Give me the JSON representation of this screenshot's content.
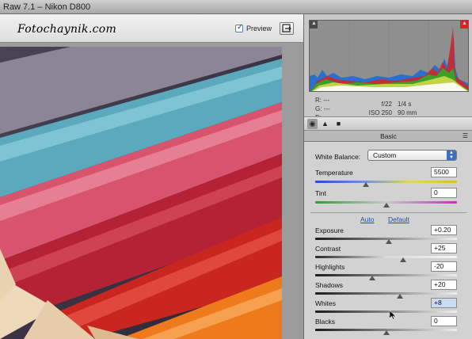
{
  "window": {
    "title": "Raw 7.1  –  Nikon D800"
  },
  "toolbar": {
    "watermark": "Fotochaynik.com",
    "preview_label": "Preview",
    "preview_checked": true
  },
  "info": {
    "r_label": "R:",
    "r_value": "---",
    "g_label": "G:",
    "g_value": "---",
    "b_label": "B:",
    "b_value": "---",
    "aperture": "f/22",
    "shutter": "1/4 s",
    "iso": "ISO 250",
    "focal": "90 mm"
  },
  "panel": {
    "title": "Basic",
    "white_balance": {
      "label": "White Balance:",
      "value": "Custom"
    },
    "auto_label": "Auto",
    "default_label": "Default",
    "sliders": [
      {
        "key": "temperature",
        "label": "Temperature",
        "value": "5500",
        "level": 0.36
      },
      {
        "key": "tint",
        "label": "Tint",
        "value": "0",
        "level": 0.5
      },
      {
        "key": "exposure",
        "label": "Exposure",
        "value": "+0.20",
        "level": 0.52
      },
      {
        "key": "contrast",
        "label": "Contrast",
        "value": "+25",
        "level": 0.62
      },
      {
        "key": "highlights",
        "label": "Highlights",
        "value": "-20",
        "level": 0.4
      },
      {
        "key": "shadows",
        "label": "Shadows",
        "value": "+20",
        "level": 0.6
      },
      {
        "key": "whites",
        "label": "Whites",
        "value": "+8",
        "level": 0.54
      },
      {
        "key": "blacks",
        "label": "Blacks",
        "value": "0",
        "level": 0.5
      }
    ]
  },
  "colors": {
    "accent": "#3c6fc4",
    "clip_highlight": "#e02020"
  }
}
